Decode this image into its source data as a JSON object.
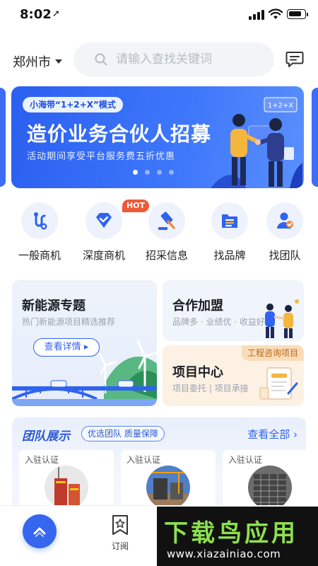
{
  "status_bar": {
    "time": "8:02",
    "battery_level": 0.85
  },
  "header": {
    "city": "郑州市",
    "search_placeholder": "请输入查找关键词"
  },
  "banner": {
    "tag": "小海带“1+2+X”模式",
    "title": "造价业务合伙人招募",
    "subtitle": "活动期间享受平台服务费五折优惠",
    "art_label": "1+2+X",
    "slides": 4,
    "active_slide": 1
  },
  "menu": {
    "items": [
      {
        "label": "一般商机",
        "icon": "route-icon"
      },
      {
        "label": "深度商机",
        "icon": "diamond-check-icon",
        "badge": "HOT"
      },
      {
        "label": "招采信息",
        "icon": "gavel-icon"
      },
      {
        "label": "找品牌",
        "icon": "folder-list-icon"
      },
      {
        "label": "找团队",
        "icon": "team-person-icon"
      }
    ]
  },
  "cards": {
    "energy": {
      "title": "新能源专题",
      "subtitle": "热门新能源项目精选推荐",
      "button": "查看详情"
    },
    "join": {
      "title": "合作加盟",
      "subtitle": "品牌多 · 业绩优 · 收益好"
    },
    "project": {
      "title": "项目中心",
      "subtitle": "项目委托 | 项目承接",
      "tag": "工程咨询项目"
    }
  },
  "team": {
    "title": "团队展示",
    "tag": "优选团队 质量保障",
    "more": "查看全部",
    "cards": [
      {
        "label": "入驻认证"
      },
      {
        "label": "入驻认证"
      },
      {
        "label": "入驻认证"
      }
    ]
  },
  "tabbar": {
    "subscribe_label": "订阅"
  },
  "watermark": {
    "title": "下载鸟应用",
    "url": "www.xiazainiao.com"
  },
  "colors": {
    "primary": "#3466ef",
    "hot": "#ee5a38",
    "project_tag": "#fbdcb9"
  }
}
